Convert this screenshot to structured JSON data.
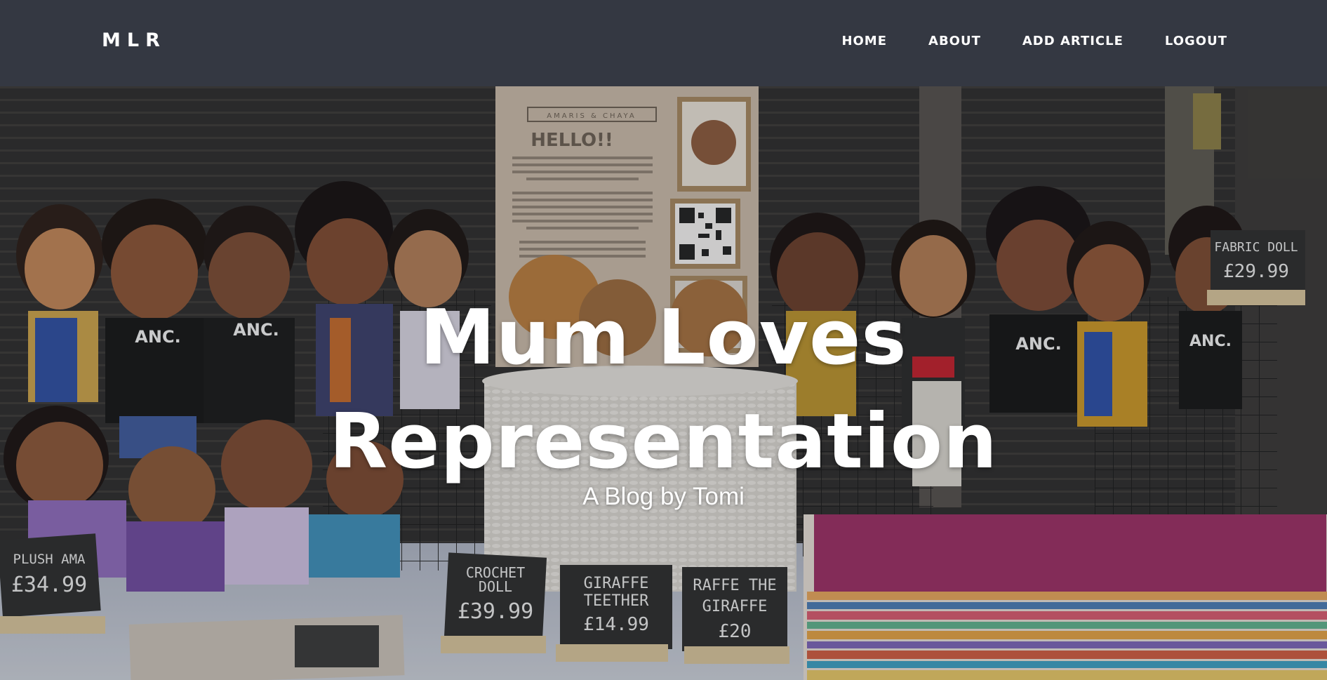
{
  "navbar": {
    "brand": "MLR",
    "links": [
      {
        "label": "HOME"
      },
      {
        "label": "ABOUT"
      },
      {
        "label": "ADD ARTICLE"
      },
      {
        "label": "LOGOUT"
      }
    ]
  },
  "hero": {
    "title": "Mum Loves Representation",
    "subtitle": "A Blog by Tomi",
    "sign": {
      "brand": "AMARIS & CHAYA",
      "greeting": "HELLO!!"
    },
    "price_tags": [
      {
        "text_line1": "PLUSH AMA",
        "text_line2": "£34.99"
      },
      {
        "text_line1": "CROCHET",
        "text_line2": "DOLL",
        "text_line3": "£39.99"
      },
      {
        "text_line1": "GIRAFFE",
        "text_line2": "TEETHER",
        "text_line3": "£14.99"
      },
      {
        "text_line1": "RAFFE THE",
        "text_line2": "GIRAFFE",
        "text_line3": "£20"
      },
      {
        "text_line1": "FABRIC DOLL",
        "text_line2": "£29.99"
      }
    ],
    "shirt_text": "ANC."
  },
  "colors": {
    "navbar_bg": "#343842",
    "text": "#ffffff"
  }
}
